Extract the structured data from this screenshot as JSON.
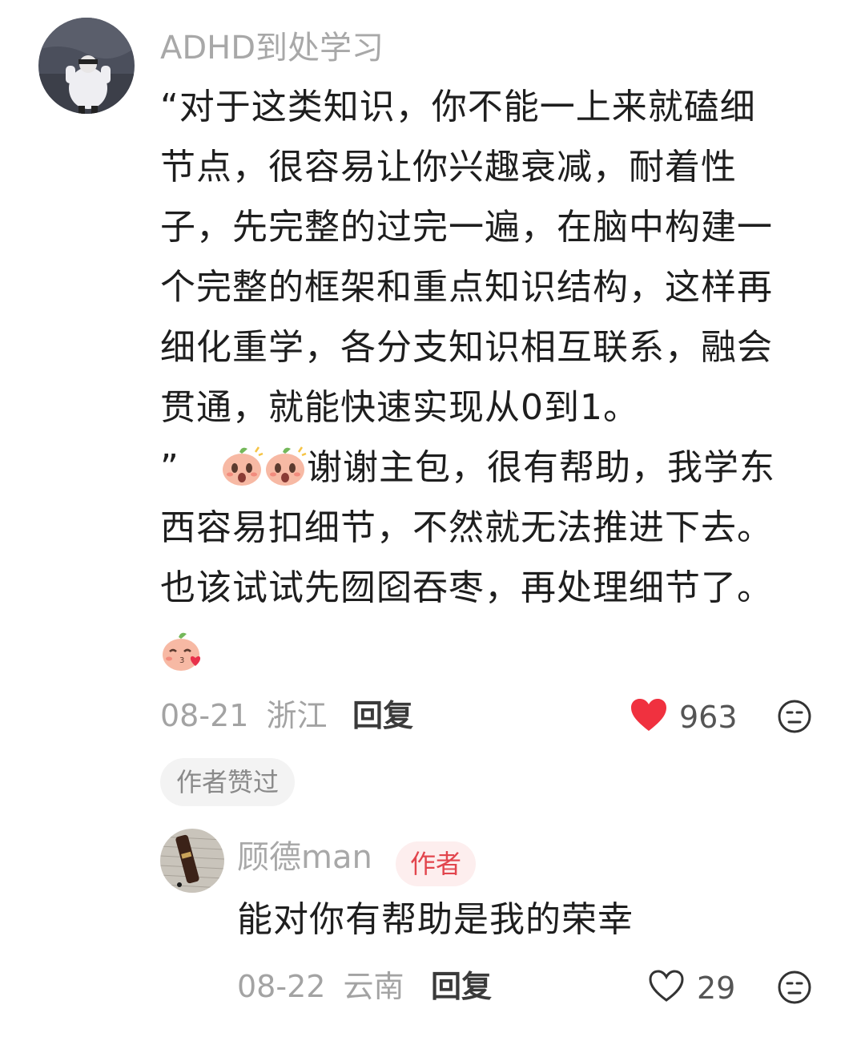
{
  "comment": {
    "username": "ADHD到处学习",
    "lines": [
      "“对于这类知识，你不能一上来就磕细",
      "节点，很容易让你兴趣衰减，耐着性",
      "子，先完整的过完一遍，在脑中构建一",
      "个完整的框架和重点知识结构，这样再",
      "细化重学，各分支知识相互联系，融会",
      "贯通，就能快速实现从0到1。"
    ],
    "quote_close": "”",
    "after_emoji_text": "谢谢主包，很有帮助，我学东",
    "lines2": [
      "西容易扣细节，不然就无法推进下去。",
      "也该试试先囫囵吞枣，再处理细节了。"
    ],
    "emojis": [
      "peach-shocked-emoji",
      "peach-shocked-emoji",
      "peach-kiss-emoji"
    ],
    "date": "08-21",
    "location": "浙江",
    "reply_label": "回复",
    "like_count": "963",
    "liked": true,
    "author_liked_label": "作者赞过"
  },
  "reply": {
    "username": "顾德man",
    "author_badge": "作者",
    "text": "能对你有帮助是我的荣幸",
    "date": "08-22",
    "location": "云南",
    "reply_label": "回复",
    "like_count": "29",
    "liked": false
  },
  "colors": {
    "like_red": "#f0313f",
    "username_gray": "#a8a8a8",
    "badge_red": "#e2454d",
    "badge_bg": "#fdeeee"
  }
}
